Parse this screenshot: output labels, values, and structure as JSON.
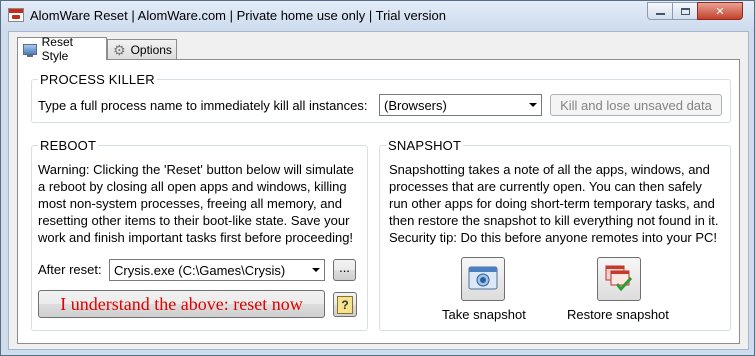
{
  "window": {
    "title": "AlomWare Reset  |  AlomWare.com  |  Private home use only  |  Trial version",
    "controls": {
      "minimize": "",
      "maximize": "",
      "close": "✕"
    }
  },
  "tabs": [
    {
      "label": "Reset Style",
      "icon": "computer-icon",
      "active": true
    },
    {
      "label": "Options",
      "icon": "gear-icon",
      "active": false
    }
  ],
  "process_killer": {
    "heading": "PROCESS KILLER",
    "prompt": "Type a full process name to immediately kill all instances:",
    "combo_value": "(Browsers)",
    "kill_button": "Kill and lose unsaved data"
  },
  "reboot": {
    "heading": "REBOOT",
    "warning_lines": [
      "Warning: Clicking the 'Reset' button below will simulate",
      "a reboot by closing all open apps and windows, killing",
      "most non-system processes, freeing all memory, and",
      "resetting other items to their boot-like state. Save your",
      "work and finish important tasks first before proceeding!"
    ],
    "after_reset_label": "After reset:",
    "after_reset_value": "Crysis.exe (C:\\Games\\Crysis)",
    "browse_button": "...",
    "reset_button": "I understand the above: reset now",
    "help_icon_glyph": "?"
  },
  "snapshot": {
    "heading": "SNAPSHOT",
    "description_lines": [
      "Snapshotting takes a note of all the apps, windows, and",
      "processes that are currently open. You can then safely",
      "run other apps for doing short-term temporary tasks, and",
      "then restore the snapshot to kill everything not found in it.",
      "Security tip: Do this before anyone remotes into your PC!"
    ],
    "take_label": "Take snapshot",
    "restore_label": "Restore snapshot"
  },
  "colors": {
    "reset_text": "#e00000",
    "accent": "#4c7fbf"
  }
}
